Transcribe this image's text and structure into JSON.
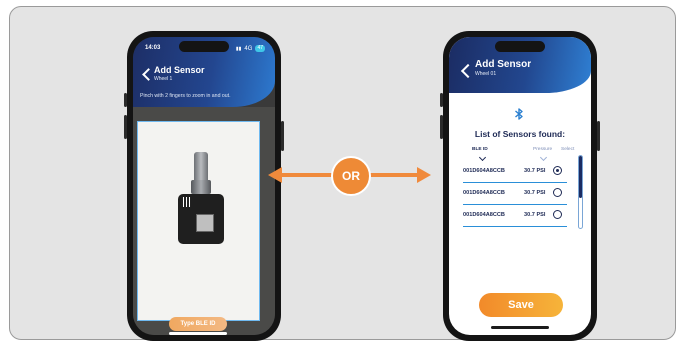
{
  "left_phone": {
    "status_time": "14:03",
    "status_signal": "4G",
    "status_battery": "47",
    "title": "Add Sensor",
    "subtitle": "Wheel 1",
    "instruction": "Pinch with 2 fingers to zoom in and out.",
    "type_ble_button": "Type BLE ID"
  },
  "connector": {
    "label": "OR",
    "color": "#f08a3c"
  },
  "right_phone": {
    "title": "Add Sensor",
    "subtitle": "Wheel 01",
    "list_title": "List of Sensors found:",
    "columns": {
      "ble_id": "BLE ID",
      "pressure": "Pressure",
      "select": "Select"
    },
    "sensors": [
      {
        "ble_id": "001D604A8CCB",
        "pressure": "30.7 PSI",
        "selected": true
      },
      {
        "ble_id": "001D604A8CCB",
        "pressure": "30.7 PSI",
        "selected": false
      },
      {
        "ble_id": "001D604A8CCB",
        "pressure": "30.7 PSI",
        "selected": false
      }
    ],
    "save_button": "Save"
  }
}
